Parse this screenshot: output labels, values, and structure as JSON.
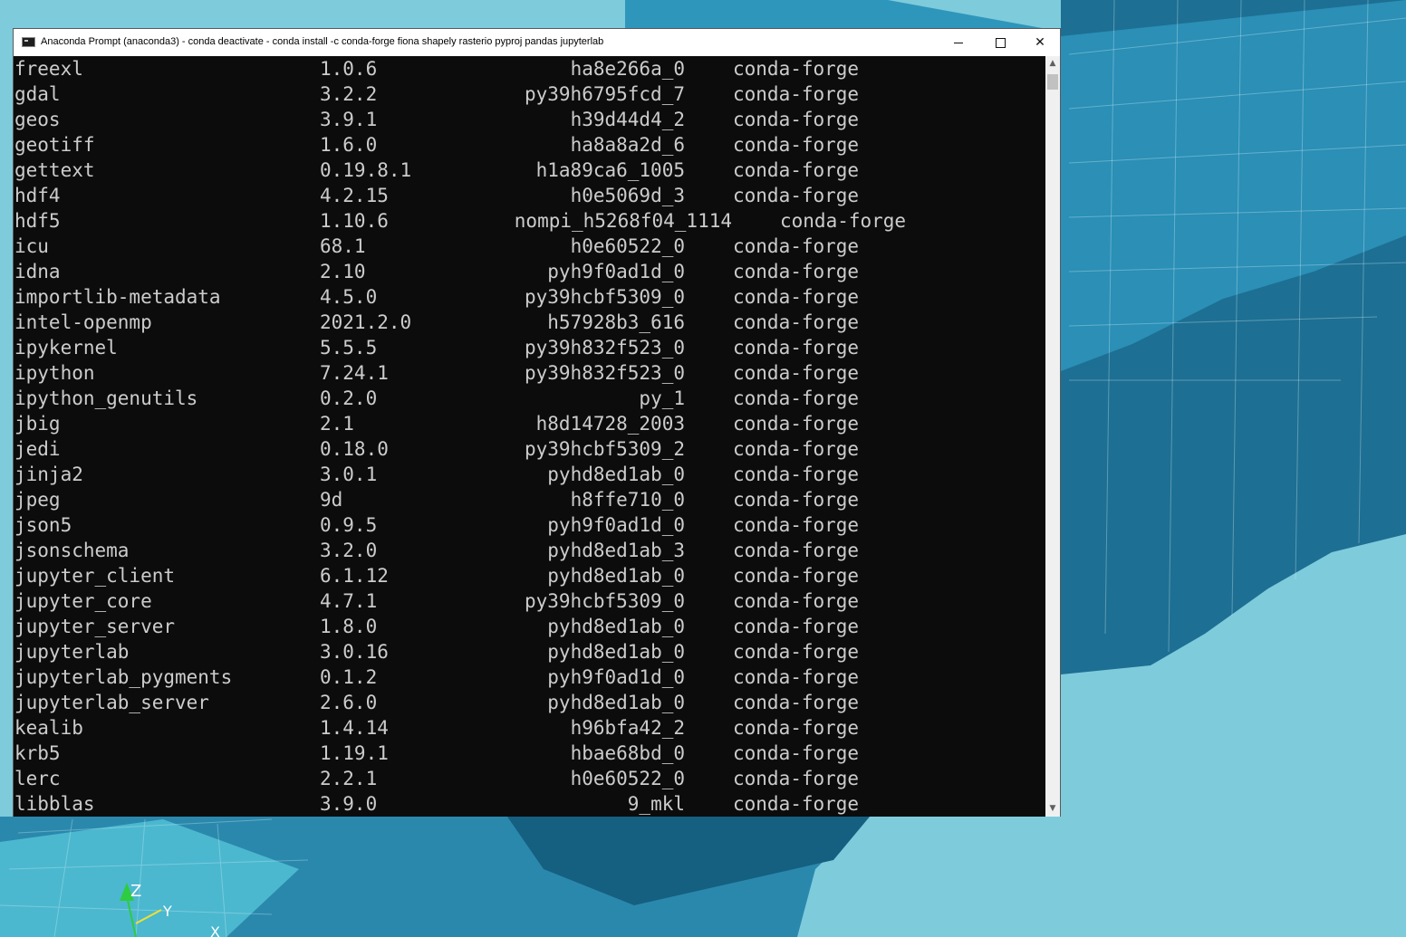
{
  "window": {
    "title": "Anaconda Prompt (anaconda3) - conda  deactivate - conda  install -c conda-forge fiona shapely rasterio pyproj pandas jupyterlab",
    "icon": "console-icon",
    "minimize_glyph": "minimize-icon",
    "maximize_glyph": "maximize-icon",
    "close_glyph": "✕"
  },
  "scrollbar": {
    "up_glyph": "▲",
    "down_glyph": "▼"
  },
  "packages": [
    {
      "name": "freexl",
      "version": "1.0.6",
      "build": "ha8e266a_0",
      "channel": "conda-forge"
    },
    {
      "name": "gdal",
      "version": "3.2.2",
      "build": "py39h6795fcd_7",
      "channel": "conda-forge"
    },
    {
      "name": "geos",
      "version": "3.9.1",
      "build": "h39d44d4_2",
      "channel": "conda-forge"
    },
    {
      "name": "geotiff",
      "version": "1.6.0",
      "build": "ha8a8a2d_6",
      "channel": "conda-forge"
    },
    {
      "name": "gettext",
      "version": "0.19.8.1",
      "build": "h1a89ca6_1005",
      "channel": "conda-forge"
    },
    {
      "name": "hdf4",
      "version": "4.2.15",
      "build": "h0e5069d_3",
      "channel": "conda-forge"
    },
    {
      "name": "hdf5",
      "version": "1.10.6",
      "build": "nompi_h5268f04_1114",
      "channel": "conda-forge"
    },
    {
      "name": "icu",
      "version": "68.1",
      "build": "h0e60522_0",
      "channel": "conda-forge"
    },
    {
      "name": "idna",
      "version": "2.10",
      "build": "pyh9f0ad1d_0",
      "channel": "conda-forge"
    },
    {
      "name": "importlib-metadata",
      "version": "4.5.0",
      "build": "py39hcbf5309_0",
      "channel": "conda-forge"
    },
    {
      "name": "intel-openmp",
      "version": "2021.2.0",
      "build": "h57928b3_616",
      "channel": "conda-forge"
    },
    {
      "name": "ipykernel",
      "version": "5.5.5",
      "build": "py39h832f523_0",
      "channel": "conda-forge"
    },
    {
      "name": "ipython",
      "version": "7.24.1",
      "build": "py39h832f523_0",
      "channel": "conda-forge"
    },
    {
      "name": "ipython_genutils",
      "version": "0.2.0",
      "build": "py_1",
      "channel": "conda-forge"
    },
    {
      "name": "jbig",
      "version": "2.1",
      "build": "h8d14728_2003",
      "channel": "conda-forge"
    },
    {
      "name": "jedi",
      "version": "0.18.0",
      "build": "py39hcbf5309_2",
      "channel": "conda-forge"
    },
    {
      "name": "jinja2",
      "version": "3.0.1",
      "build": "pyhd8ed1ab_0",
      "channel": "conda-forge"
    },
    {
      "name": "jpeg",
      "version": "9d",
      "build": "h8ffe710_0",
      "channel": "conda-forge"
    },
    {
      "name": "json5",
      "version": "0.9.5",
      "build": "pyh9f0ad1d_0",
      "channel": "conda-forge"
    },
    {
      "name": "jsonschema",
      "version": "3.2.0",
      "build": "pyhd8ed1ab_3",
      "channel": "conda-forge"
    },
    {
      "name": "jupyter_client",
      "version": "6.1.12",
      "build": "pyhd8ed1ab_0",
      "channel": "conda-forge"
    },
    {
      "name": "jupyter_core",
      "version": "4.7.1",
      "build": "py39hcbf5309_0",
      "channel": "conda-forge"
    },
    {
      "name": "jupyter_server",
      "version": "1.8.0",
      "build": "pyhd8ed1ab_0",
      "channel": "conda-forge"
    },
    {
      "name": "jupyterlab",
      "version": "3.0.16",
      "build": "pyhd8ed1ab_0",
      "channel": "conda-forge"
    },
    {
      "name": "jupyterlab_pygments",
      "version": "0.1.2",
      "build": "pyh9f0ad1d_0",
      "channel": "conda-forge"
    },
    {
      "name": "jupyterlab_server",
      "version": "2.6.0",
      "build": "pyhd8ed1ab_0",
      "channel": "conda-forge"
    },
    {
      "name": "kealib",
      "version": "1.4.14",
      "build": "h96bfa42_2",
      "channel": "conda-forge"
    },
    {
      "name": "krb5",
      "version": "1.19.1",
      "build": "hbae68bd_0",
      "channel": "conda-forge"
    },
    {
      "name": "lerc",
      "version": "2.2.1",
      "build": "h0e60522_0",
      "channel": "conda-forge"
    },
    {
      "name": "libblas",
      "version": "3.9.0",
      "build": "9_mkl",
      "channel": "conda-forge"
    }
  ],
  "colors": {
    "console_bg": "#0c0c0c",
    "console_fg": "#cccccc",
    "terrain_dark": "#1d6f93",
    "terrain_light": "#3aa7c9",
    "sky": "#7ecbdc"
  },
  "axis_labels": {
    "z": "Z",
    "y": "Y",
    "x": "X"
  }
}
